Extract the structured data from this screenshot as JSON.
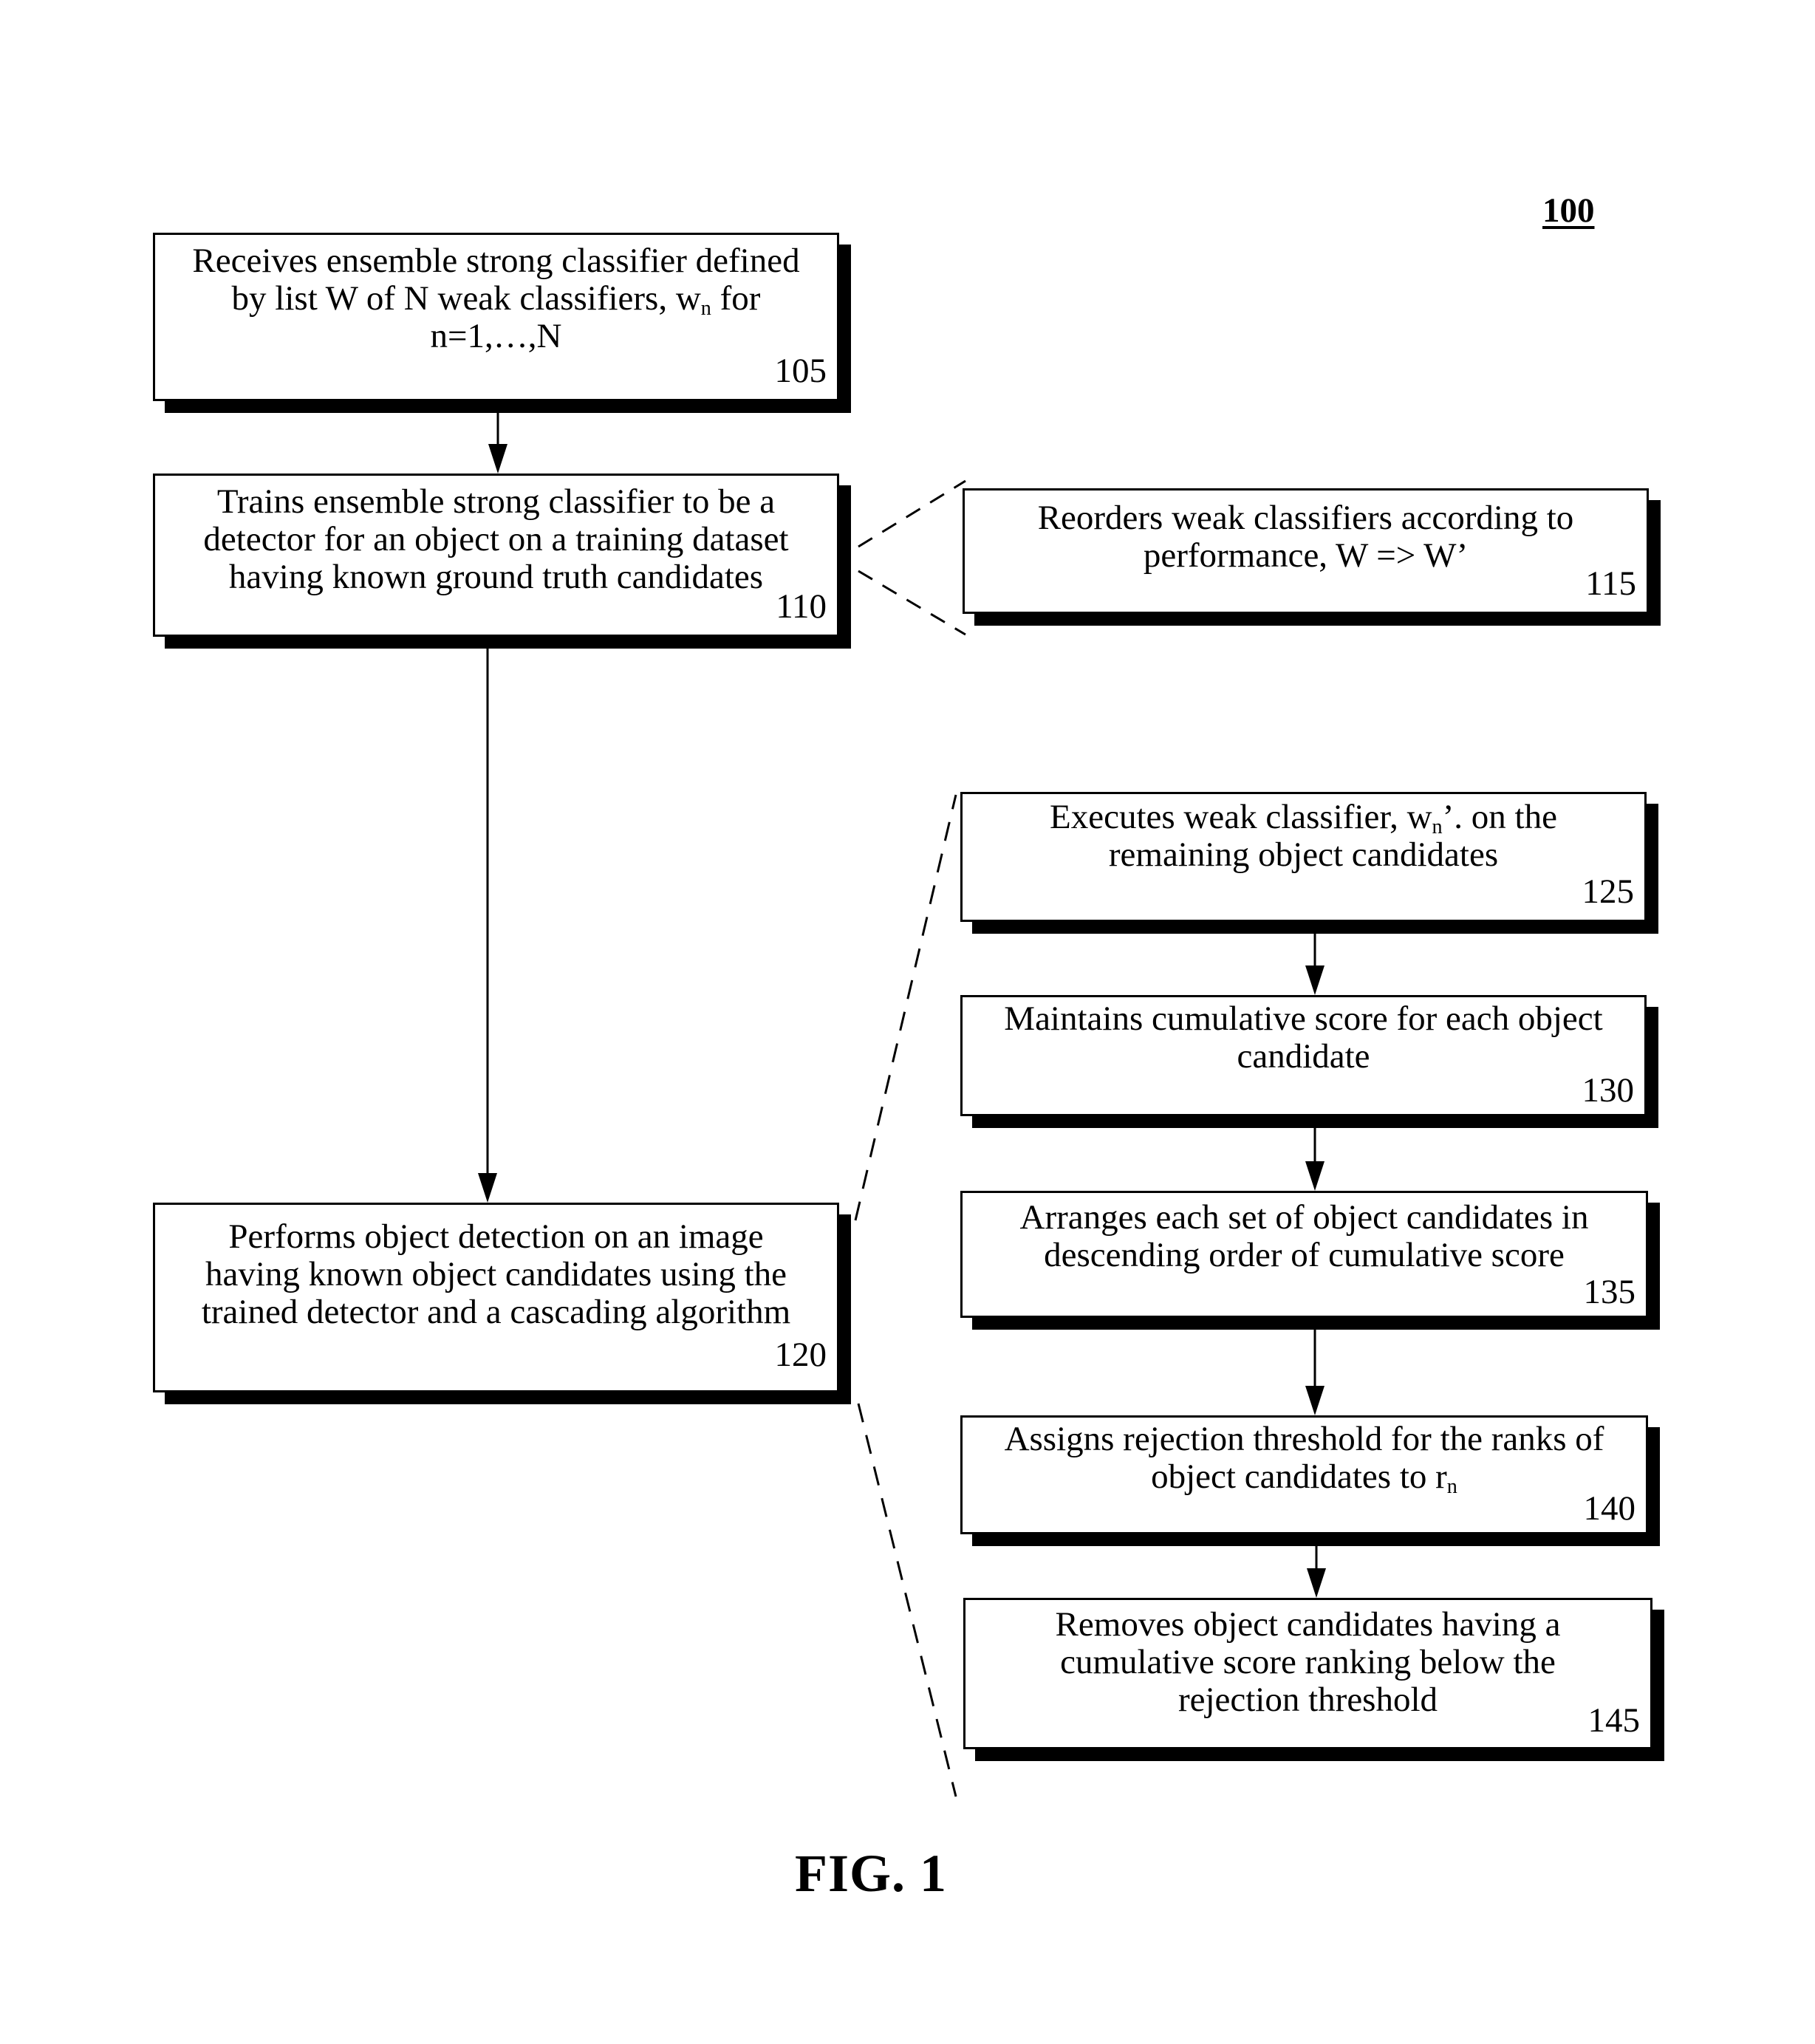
{
  "figure": {
    "reference_numeral": "100",
    "caption": "FIG. 1"
  },
  "steps": [
    {
      "id": "105",
      "lines": [
        "Receives ensemble strong classifier defined",
        "by list W of N weak classifiers, w{n} for",
        "n=1,…,N"
      ]
    },
    {
      "id": "110",
      "lines": [
        "Trains ensemble strong classifier to be a",
        "detector for an object on a training dataset",
        "having known ground truth candidates"
      ]
    },
    {
      "id": "115",
      "lines": [
        "Reorders weak classifiers according to",
        "performance, W => W’"
      ]
    },
    {
      "id": "120",
      "lines": [
        "Performs object detection on an image",
        "having known object candidates using the",
        "trained detector and a cascading algorithm"
      ]
    },
    {
      "id": "125",
      "lines": [
        "Executes weak classifier, w{n}’. on the",
        "remaining object candidates"
      ]
    },
    {
      "id": "130",
      "lines": [
        "Maintains cumulative score for each object",
        "candidate"
      ]
    },
    {
      "id": "135",
      "lines": [
        "Arranges each set of object candidates in",
        "descending order of cumulative score"
      ]
    },
    {
      "id": "140",
      "lines": [
        "Assigns rejection threshold for the ranks of",
        "object candidates to r{n}"
      ]
    },
    {
      "id": "145",
      "lines": [
        "Removes object candidates having a",
        "cumulative score ranking below the",
        "rejection threshold"
      ]
    }
  ],
  "connections": [
    {
      "from": "105",
      "to": "110",
      "type": "arrow"
    },
    {
      "from": "110",
      "to": "120",
      "type": "arrow"
    },
    {
      "from": "110",
      "to": "115",
      "type": "dashed-expansion"
    },
    {
      "from": "120",
      "to": "125-145",
      "type": "dashed-expansion"
    },
    {
      "from": "125",
      "to": "130",
      "type": "arrow"
    },
    {
      "from": "130",
      "to": "135",
      "type": "arrow"
    },
    {
      "from": "135",
      "to": "140",
      "type": "arrow"
    },
    {
      "from": "140",
      "to": "145",
      "type": "arrow"
    }
  ]
}
